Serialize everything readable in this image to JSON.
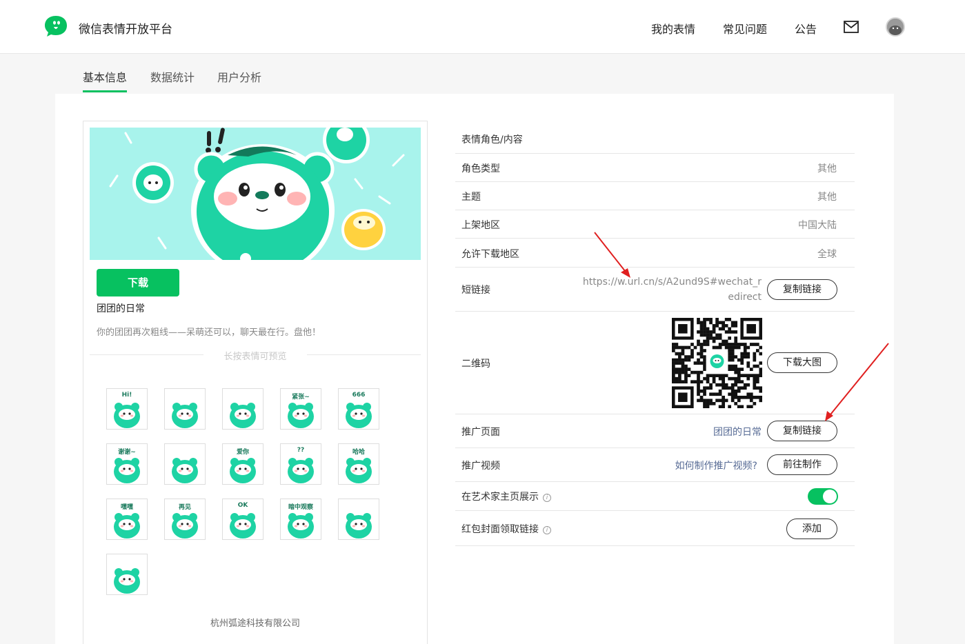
{
  "header": {
    "brand": "微信表情开放平台",
    "nav": [
      "我的表情",
      "常见问题",
      "公告"
    ],
    "mail_icon": "mail-icon",
    "avatar": "user-avatar"
  },
  "tabs": [
    {
      "label": "基本信息",
      "active": true
    },
    {
      "label": "数据统计",
      "active": false
    },
    {
      "label": "用户分析",
      "active": false
    }
  ],
  "pack": {
    "download_label": "下载",
    "name": "团团的日常",
    "description": "你的团团再次粗线——呆萌还可以，聊天最在行。盘他！",
    "preview_hint": "长按表情可预览",
    "company": "杭州弧途科技有限公司",
    "stickers": [
      {
        "caption": "Hi!"
      },
      {
        "caption": ""
      },
      {
        "caption": ""
      },
      {
        "caption": "紧张~"
      },
      {
        "caption": "666"
      },
      {
        "caption": "谢谢~"
      },
      {
        "caption": ""
      },
      {
        "caption": "爱你"
      },
      {
        "caption": "??"
      },
      {
        "caption": "哈哈"
      },
      {
        "caption": "嘿嘿"
      },
      {
        "caption": "再见"
      },
      {
        "caption": "OK"
      },
      {
        "caption": "暗中观察"
      },
      {
        "caption": ""
      },
      {
        "caption": ""
      }
    ]
  },
  "info": {
    "section_title": "表情角色/内容",
    "role_type": {
      "label": "角色类型",
      "value": "其他"
    },
    "theme": {
      "label": "主题",
      "value": "其他"
    },
    "region": {
      "label": "上架地区",
      "value": "中国大陆"
    },
    "download_region": {
      "label": "允许下载地区",
      "value": "全球"
    },
    "short_link": {
      "label": "短链接",
      "url": "https://w.url.cn/s/A2und9S#wechat_redirect",
      "button": "复制链接"
    },
    "qr_code": {
      "label": "二维码",
      "button": "下载大图"
    },
    "promo_page": {
      "label": "推广页面",
      "value": "团团的日常",
      "button": "复制链接"
    },
    "promo_video": {
      "label": "推广视频",
      "value": "如何制作推广视频?",
      "button": "前往制作"
    },
    "artist_page": {
      "label": "在艺术家主页展示",
      "toggle_on": true
    },
    "red_packet": {
      "label": "红包封面领取链接",
      "button": "添加"
    }
  },
  "colors": {
    "accent": "#07c160",
    "link": "#576b95",
    "annotation": "#e02020"
  }
}
